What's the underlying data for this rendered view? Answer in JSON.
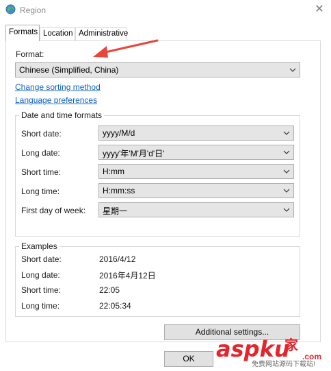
{
  "window": {
    "title": "Region",
    "close_glyph": "✕"
  },
  "tabs": [
    {
      "label": "Formats"
    },
    {
      "label": "Location"
    },
    {
      "label": "Administrative"
    }
  ],
  "format": {
    "label": "Format:",
    "selected": "Chinese (Simplified, China)"
  },
  "links": {
    "sorting": "Change sorting method",
    "language": "Language preferences"
  },
  "datetime": {
    "title": "Date and time formats",
    "rows": [
      {
        "label": "Short date:",
        "value": "yyyy/M/d"
      },
      {
        "label": "Long date:",
        "value": "yyyy'年'M'月'd'日'"
      },
      {
        "label": "Short time:",
        "value": "H:mm"
      },
      {
        "label": "Long time:",
        "value": "H:mm:ss"
      },
      {
        "label": "First day of week:",
        "value": "星期一"
      }
    ]
  },
  "examples": {
    "title": "Examples",
    "rows": [
      {
        "label": "Short date:",
        "value": "2016/4/12"
      },
      {
        "label": "Long date:",
        "value": "2016年4月12日"
      },
      {
        "label": "Short time:",
        "value": "22:05"
      },
      {
        "label": "Long time:",
        "value": "22:05:34"
      }
    ]
  },
  "buttons": {
    "additional": "Additional settings...",
    "ok": "OK"
  },
  "watermark": {
    "logo": "aspku",
    "logo_suffix": "家",
    "domain": ".com",
    "tagline": "免费网站源码下载站!"
  },
  "colors": {
    "arrow": "#e8453c",
    "link": "#0d63c4",
    "watermark_red": "#e3262e"
  }
}
